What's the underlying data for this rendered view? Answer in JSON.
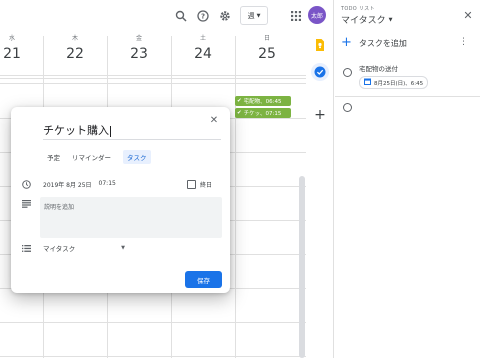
{
  "header": {
    "view_label": "週",
    "avatar_text": "太郎"
  },
  "week": {
    "days": [
      {
        "dow": "水",
        "date": "21"
      },
      {
        "dow": "木",
        "date": "22"
      },
      {
        "dow": "金",
        "date": "23"
      },
      {
        "dow": "土",
        "date": "24"
      },
      {
        "dow": "日",
        "date": "25"
      }
    ]
  },
  "calendar_events": [
    {
      "label": "宅配物、06:45"
    },
    {
      "label": "チケッ、07:15"
    }
  ],
  "tasks_panel": {
    "subtitle": "TODO リスト",
    "title": "マイタスク",
    "add_label": "タスクを追加",
    "tasks": [
      {
        "title": "宅配物の送付",
        "date": "8月25日(日)、6:45"
      }
    ]
  },
  "dialog": {
    "title": "チケット購入",
    "tabs": [
      "予定",
      "リマインダー",
      "タスク"
    ],
    "active_tab": "タスク",
    "date": "2019年 8月 25日",
    "time": "07:15",
    "allday_label": "終日",
    "description_placeholder": "説明を追加",
    "list_value": "マイタスク",
    "save_label": "保存"
  },
  "colors": {
    "accent": "#1a73e8",
    "event_green": "#7cb342",
    "avatar": "#7a55c7",
    "keep_yellow": "#fbbc04"
  },
  "icons": [
    "search-icon",
    "help-icon",
    "settings-icon",
    "apps-grid-icon",
    "keep-icon",
    "tasks-icon",
    "add-icon",
    "close-icon",
    "clock-icon",
    "description-icon",
    "list-icon",
    "more-vert-icon",
    "calendar-icon",
    "checkmark-icon"
  ]
}
